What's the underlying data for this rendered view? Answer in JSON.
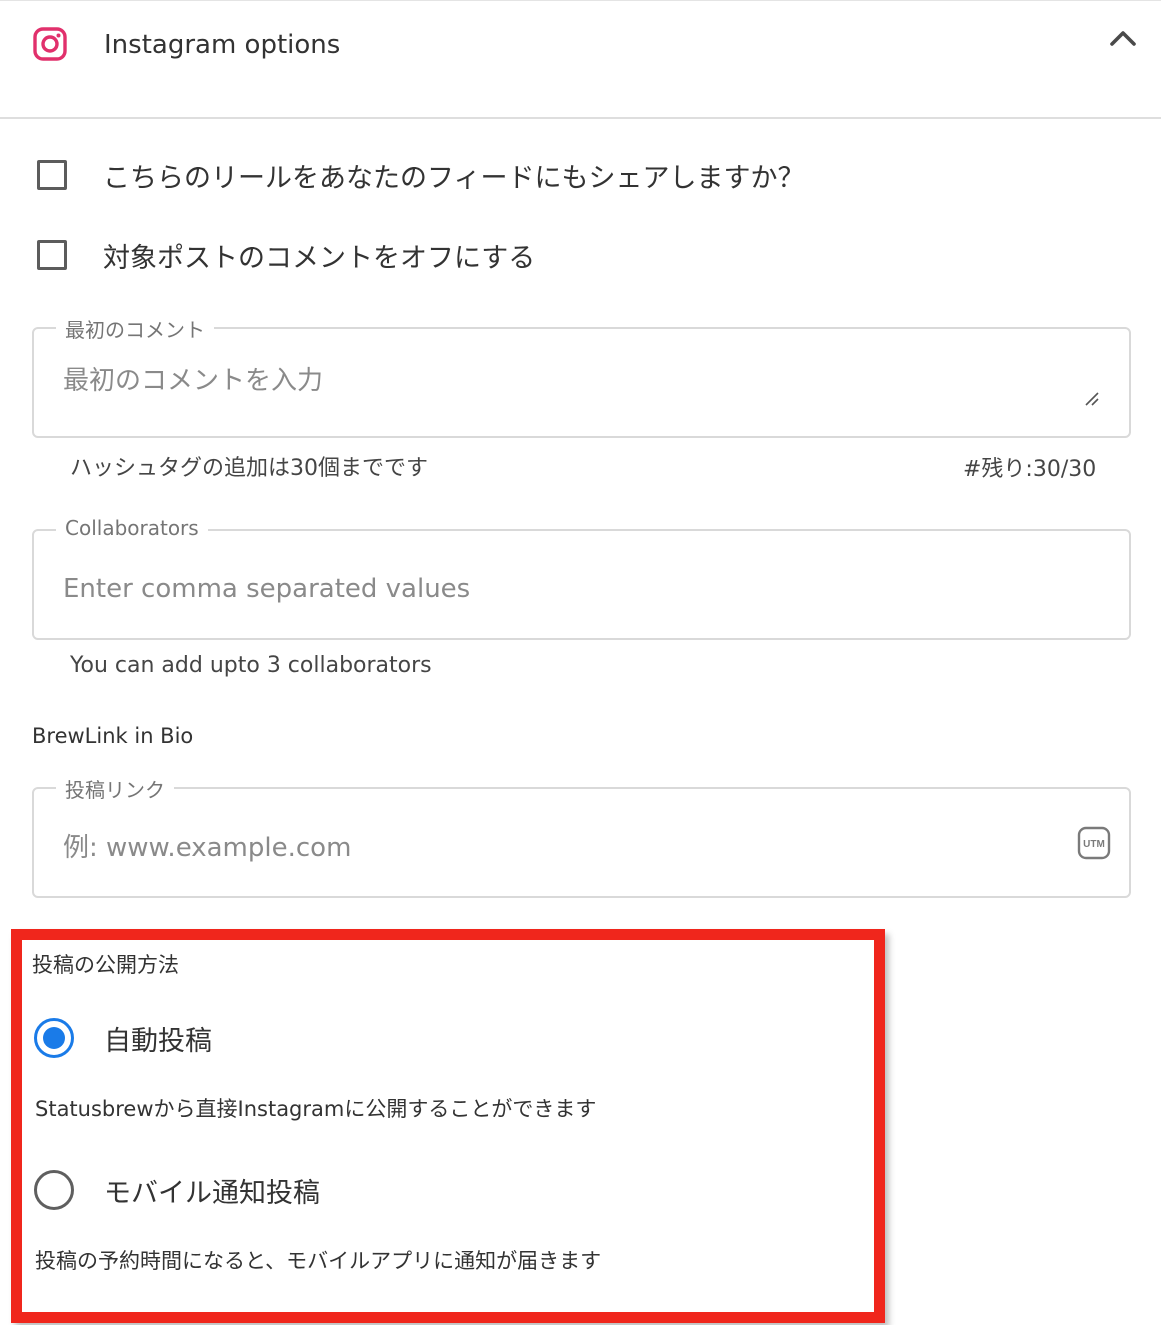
{
  "header": {
    "title": "Instagram options",
    "icon": "instagram-icon",
    "collapse_icon": "chevron-up-icon",
    "brand_color": "#e1306c"
  },
  "options": {
    "share_reel_to_feed": {
      "label": "こちらのリールをあなたのフィードにもシェアしますか？",
      "checked": false
    },
    "turn_off_comments": {
      "label": "対象ポストのコメントをオフにする",
      "checked": false
    }
  },
  "first_comment": {
    "label": "最初のコメント",
    "placeholder": "最初のコメントを入力",
    "value": "",
    "hint": "ハッシュタグの追加は30個までです",
    "counter": "#残り:30/30"
  },
  "collaborators": {
    "label": "Collaborators",
    "placeholder": "Enter comma separated values",
    "value": "",
    "hint": "You can add upto 3 collaborators"
  },
  "brewlink": {
    "section_label": "BrewLink in Bio",
    "field_label": "投稿リンク",
    "placeholder": "例: www.example.com",
    "value": "",
    "utm_icon_text": "UTM"
  },
  "publishing": {
    "section_label": "投稿の公開方法",
    "accent_color": "#1a7be8",
    "highlight_color": "#f0261c",
    "selected": "auto",
    "methods": [
      {
        "id": "auto",
        "label": "自動投稿",
        "description": "Statusbrewから直接Instagramに公開することができます"
      },
      {
        "id": "mobile",
        "label": "モバイル通知投稿",
        "description": "投稿の予約時間になると、モバイルアプリに通知が届きます"
      }
    ]
  }
}
